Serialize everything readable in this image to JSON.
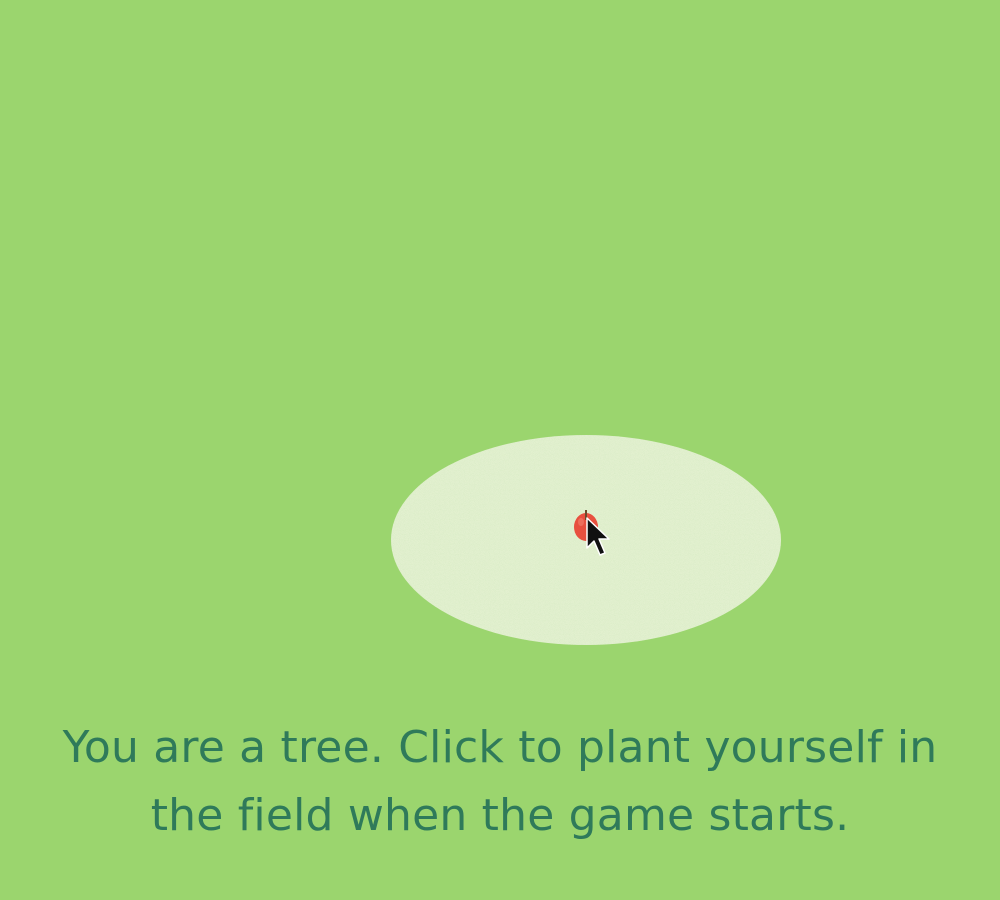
{
  "game": {
    "instruction": "You are a tree. Click to plant yourself in the field when the game starts."
  },
  "colors": {
    "grass": "#9bd56e",
    "clearing": "#e2f0cf",
    "seed": "#e8503f",
    "text": "#2f7a5a"
  },
  "icons": {
    "seed": "apple-seed-icon",
    "pointer": "mouse-pointer-icon"
  }
}
